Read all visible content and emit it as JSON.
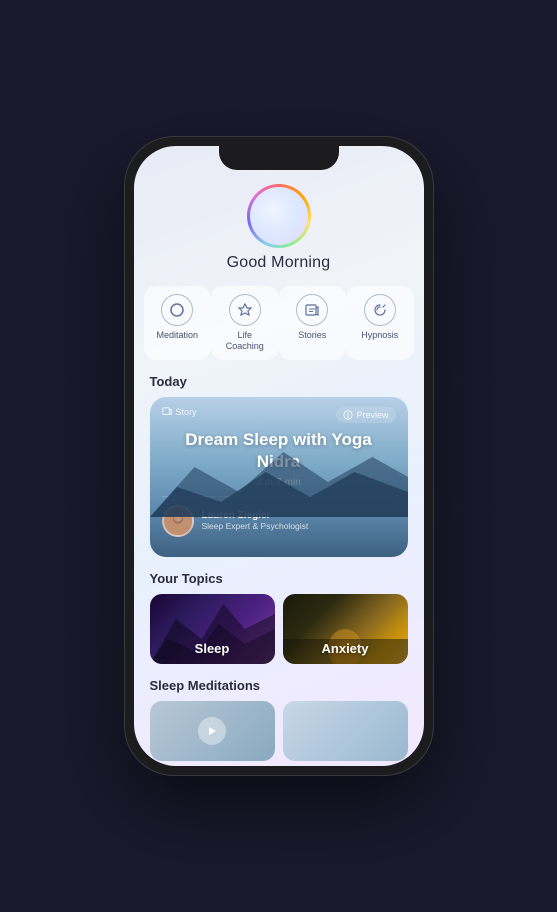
{
  "app": {
    "greeting": "Good Morning"
  },
  "categories": [
    {
      "id": "meditation",
      "label": "Meditation",
      "icon": "○"
    },
    {
      "id": "life-coaching",
      "label": "Life Coaching",
      "icon": "🎓"
    },
    {
      "id": "stories",
      "label": "Stories",
      "icon": "📖"
    },
    {
      "id": "hypnosis",
      "label": "Hypnosis",
      "icon": "⟳"
    }
  ],
  "today": {
    "section_title": "Today",
    "card": {
      "type_label": "Story",
      "preview_label": "Preview",
      "title": "Dream Sleep with Yoga Nidra",
      "duration": "3 or 7 min",
      "author_name": "Lauren Ziegler",
      "author_role": "Sleep Expert & Psychologist"
    }
  },
  "topics": {
    "section_title": "Your Topics",
    "items": [
      {
        "id": "sleep",
        "label": "Sleep"
      },
      {
        "id": "anxiety",
        "label": "Anxiety"
      }
    ]
  },
  "sleep_meditations": {
    "section_title": "Sleep Meditations"
  }
}
